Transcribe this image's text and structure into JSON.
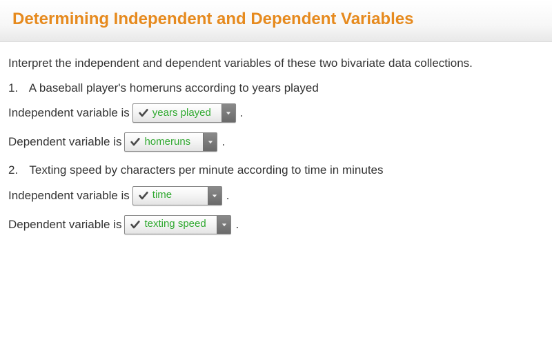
{
  "header": {
    "title": "Determining Independent and Dependent Variables"
  },
  "content": {
    "instruction": "Interpret the independent and dependent variables of these two bivariate data collections.",
    "items": [
      {
        "num": "1.",
        "prompt": "A baseball player's homeruns according to years played",
        "independent": {
          "label": "Independent variable is",
          "value": "years played"
        },
        "dependent": {
          "label": "Dependent variable is",
          "value": "homeruns"
        }
      },
      {
        "num": "2.",
        "prompt": "Texting speed by characters per minute according to time in minutes",
        "independent": {
          "label": "Independent variable is",
          "value": "time"
        },
        "dependent": {
          "label": "Dependent variable is",
          "value": "texting speed"
        }
      }
    ],
    "period": "."
  }
}
